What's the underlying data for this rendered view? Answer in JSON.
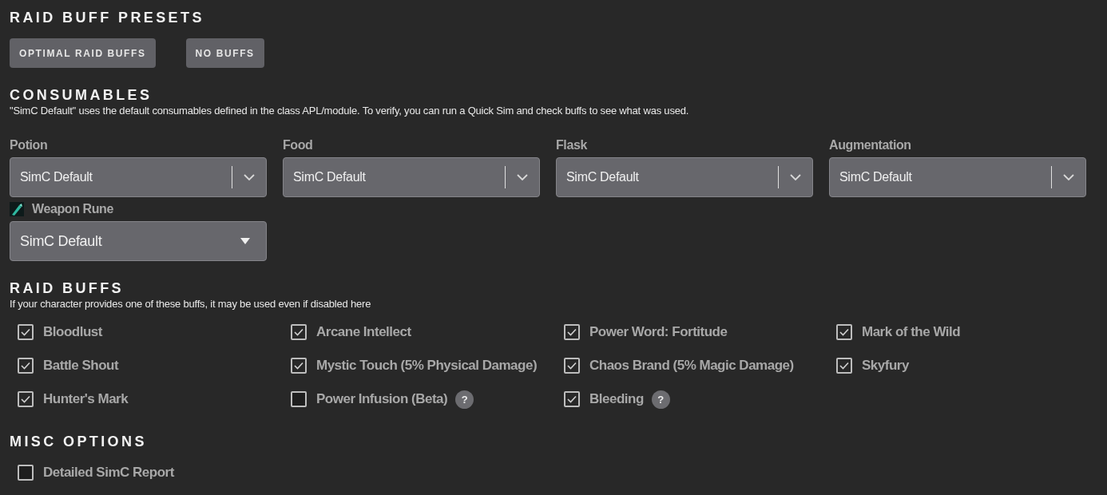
{
  "presets": {
    "title": "RAID BUFF PRESETS",
    "buttons": [
      "OPTIMAL RAID BUFFS",
      "NO BUFFS"
    ]
  },
  "consumables": {
    "title": "CONSUMABLES",
    "description": "\"SimC Default\" uses the default consumables defined in the class APL/module. To verify, you can run a Quick Sim and check buffs to see what was used.",
    "fields": [
      {
        "label": "Potion",
        "value": "SimC Default",
        "kind": "select"
      },
      {
        "label": "Food",
        "value": "SimC Default",
        "kind": "select"
      },
      {
        "label": "Flask",
        "value": "SimC Default",
        "kind": "select"
      },
      {
        "label": "Augmentation",
        "value": "SimC Default",
        "kind": "select"
      },
      {
        "label": "Weapon Rune",
        "value": "SimC Default",
        "kind": "native",
        "icon": true
      }
    ]
  },
  "raid_buffs": {
    "title": "RAID BUFFS",
    "description": "If your character provides one of these buffs, it may be used even if disabled here",
    "items": [
      {
        "label": "Bloodlust",
        "checked": true
      },
      {
        "label": "Arcane Intellect",
        "checked": true
      },
      {
        "label": "Power Word: Fortitude",
        "checked": true
      },
      {
        "label": "Mark of the Wild",
        "checked": true
      },
      {
        "label": "Battle Shout",
        "checked": true
      },
      {
        "label": "Mystic Touch (5% Physical Damage)",
        "checked": true
      },
      {
        "label": "Chaos Brand (5% Magic Damage)",
        "checked": true
      },
      {
        "label": "Skyfury",
        "checked": true
      },
      {
        "label": "Hunter's Mark",
        "checked": true
      },
      {
        "label": "Power Infusion (Beta)",
        "checked": false,
        "help": "?"
      },
      {
        "label": "Bleeding",
        "checked": true,
        "help": "?"
      }
    ]
  },
  "misc_options": {
    "title": "MISC OPTIONS",
    "items": [
      {
        "label": "Detailed SimC Report",
        "checked": false
      }
    ]
  }
}
